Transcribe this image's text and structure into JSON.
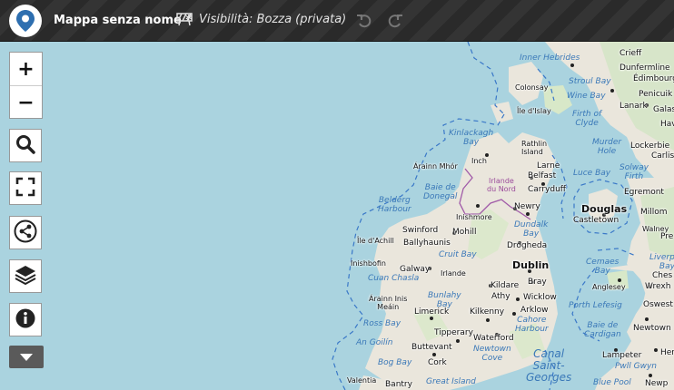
{
  "header": {
    "map_title": "Mappa senza nome *",
    "visibility": "Visibilità: Bozza (privata)"
  },
  "icons": {
    "logo": "map-pin-logo-icon",
    "visibility": "visibility-striped-icon",
    "undo": "undo-icon",
    "redo": "redo-icon",
    "search": "search-icon",
    "fullscreen": "fullscreen-icon",
    "share": "share-icon",
    "layers": "layers-icon",
    "info": "info-icon",
    "more": "caret-down-icon"
  },
  "controls": {
    "zoom_in": "+",
    "zoom_out": "−"
  },
  "map": {
    "cities": {
      "dublin": "Dublin",
      "belfast": "Belfast",
      "douglas": "Douglas",
      "galway": "Galway",
      "limerick": "Limerick",
      "cork": "Cork",
      "waterford": "Waterford",
      "kilkenny": "Kilkenny",
      "drogheda": "Drogheda",
      "newry": "Newry",
      "larne": "Larne",
      "carryduff": "Carryduff",
      "castletown": "Castletown",
      "swinford": "Swinford",
      "ballyhaunis": "Ballyhaunis",
      "mohill": "Mohill",
      "irlande": "Irlande",
      "kildare": "Kildare",
      "athy": "Athy",
      "bray": "Bray",
      "wicklow": "Wicklow",
      "arklow": "Arklow",
      "tipperary": "Tipperary",
      "buttevant": "Buttevant",
      "bantry": "Bantry",
      "inch": "Inch",
      "inishmore": "Inishmore",
      "arainn_mhor": "Árainn Mhór",
      "ile_dachill": "Île d'Achill",
      "inishbofin": "Inishbofin",
      "arainn_inis_meain": "Árainn Inis\nMeáin",
      "valentia": "Valentia",
      "crieff": "Crieff",
      "dunfermline": "Dunfermline",
      "edimbourg": "Édimbourg",
      "stroul_bay": "Stroul Bay",
      "penicuik": "Penicuik",
      "lanark": "Lanark",
      "galas": "Galas",
      "hav": "Hav",
      "lockerbie": "Lockerbie",
      "carlis": "Carlis",
      "egremont": "Egremont",
      "millom": "Millom",
      "walney": "Walney",
      "pre": "Pre",
      "ches": "Ches",
      "wrexh": "Wrexh",
      "oswest": "Oswest",
      "anglesey": "Anglesey",
      "newtown": "Newtown",
      "lampeter": "Lampeter",
      "her": "Her",
      "newp": "Newp",
      "colonsay": "Colonsay",
      "ile_disla": "Île d'Islay",
      "rathlin": "Rathlin\nIsland"
    },
    "waters": {
      "inner_hebrides": "Inner Hebrides",
      "kinlackagh": "Kinlackagh\nBay",
      "baie_donegal": "Baie de\nDonegal",
      "belderg": "Belderg\nHarbour",
      "dundalk": "Dundalk\nBay",
      "cruit": "Cruit Bay",
      "cuan_chasla": "Cuan Chasla",
      "bunlahy": "Bunlahy\nBay",
      "ross_bay": "Ross Bay",
      "an_goilin": "An Goilín",
      "bog_bay": "Bog Bay",
      "cahore": "Cahore\nHarbour",
      "newtown_cove": "Newtown\nCove",
      "canal_saint_georges": "Canal\nSaint-\nGeorges",
      "great_island": "Great Island",
      "wine_bay": "Wine Bay",
      "firth_clyde": "Firth of\nClyde",
      "murder_hole": "Murder\nHole",
      "luce_bay": "Luce Bay",
      "solway": "Solway\nFirth",
      "cemaes": "Cemaes\nBay",
      "liverpool": "Liverpoo\nBay",
      "porth_lefesig": "Porth Lefesig",
      "baie_cardigan": "Baie de\nCardigan",
      "pwll_gwyn": "Pwll Gwyn",
      "blue_pool": "Blue Pool"
    },
    "regions": {
      "irlande_du_nord": "Irlande\ndu Nord"
    }
  }
}
